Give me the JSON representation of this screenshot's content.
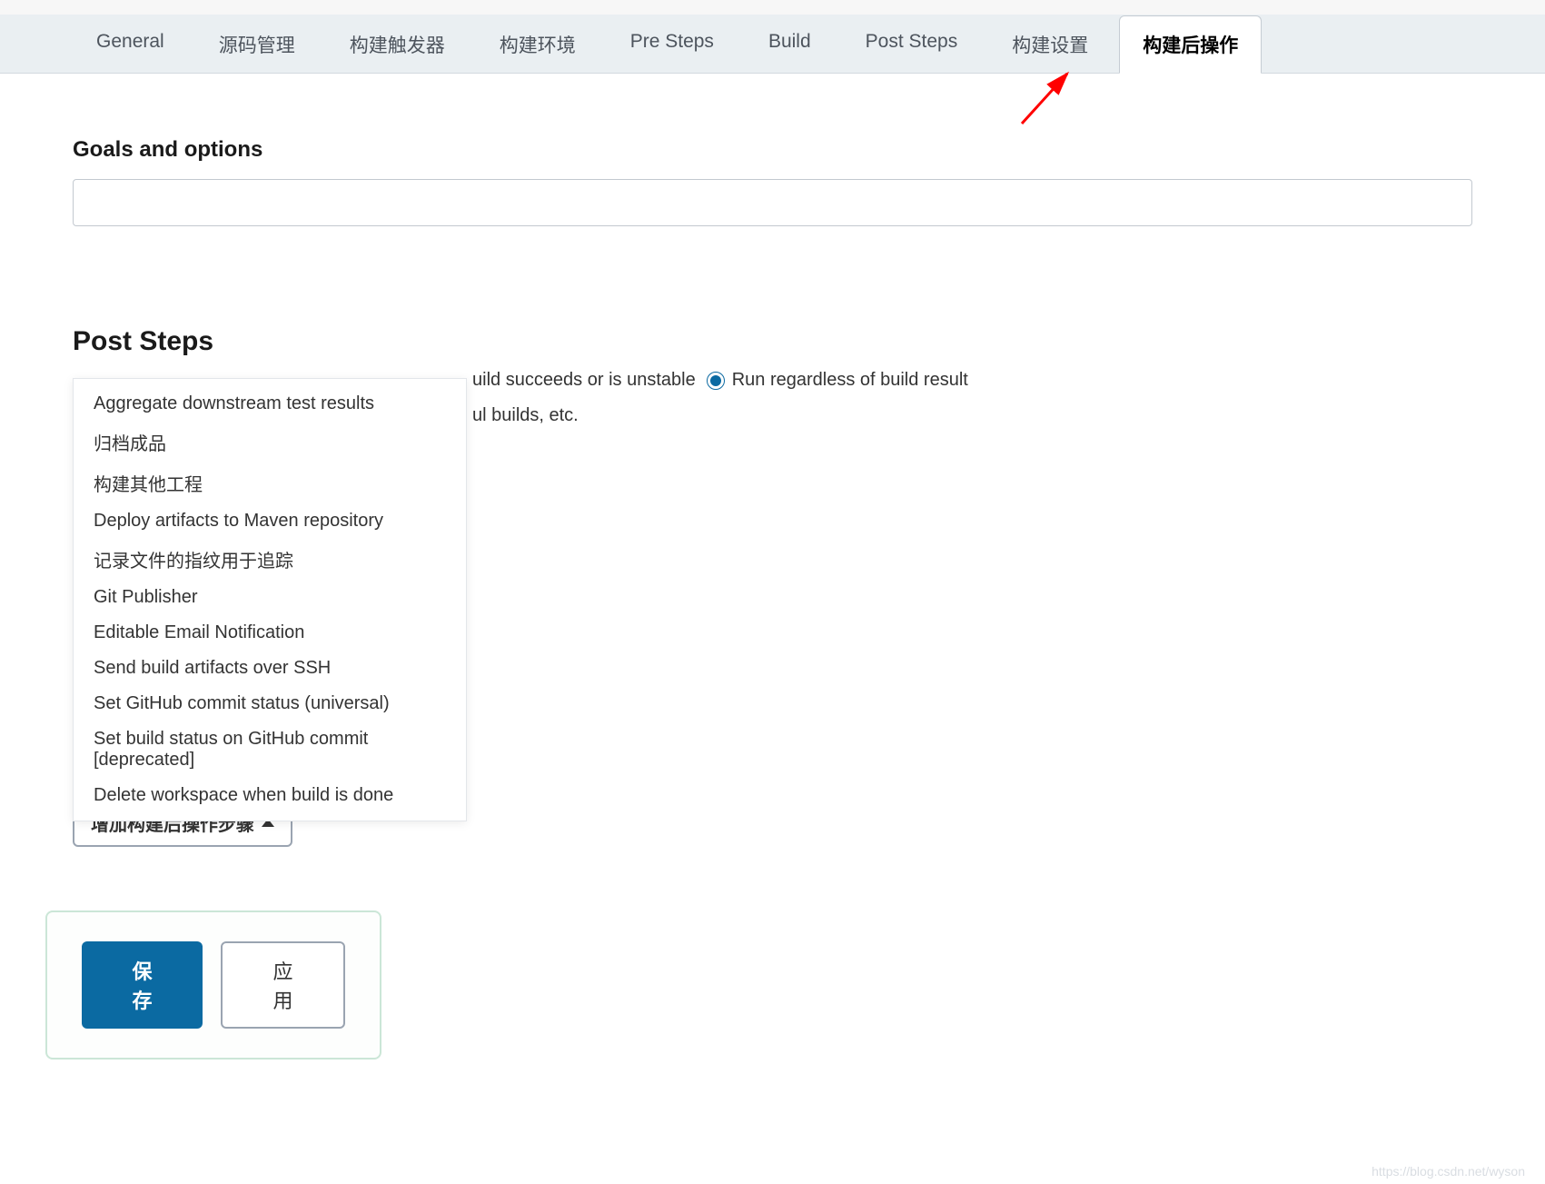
{
  "tabs": [
    {
      "label": "General"
    },
    {
      "label": "源码管理"
    },
    {
      "label": "构建触发器"
    },
    {
      "label": "构建环境"
    },
    {
      "label": "Pre Steps"
    },
    {
      "label": "Build"
    },
    {
      "label": "Post Steps"
    },
    {
      "label": "构建设置"
    },
    {
      "label": "构建后操作",
      "active": true
    }
  ],
  "sections": {
    "goals_label": "Goals and options",
    "goals_value": "",
    "post_steps_title": "Post Steps",
    "radio_option_2_partial": "uild succeeds or is unstable",
    "radio_option_3": "Run regardless of build result",
    "help_partial": "ul builds, etc."
  },
  "dropdown": {
    "items": [
      "Aggregate downstream test results",
      "归档成品",
      "构建其他工程",
      "Deploy artifacts to Maven repository",
      "记录文件的指纹用于追踪",
      "Git Publisher",
      "Editable Email Notification",
      "Send build artifacts over SSH",
      "Set GitHub commit status (universal)",
      "Set build status on GitHub commit [deprecated]",
      "Delete workspace when build is done"
    ]
  },
  "buttons": {
    "add_post_build": "增加构建后操作步骤",
    "save": "保存",
    "apply": "应用"
  },
  "watermark": "https://blog.csdn.net/wyson"
}
